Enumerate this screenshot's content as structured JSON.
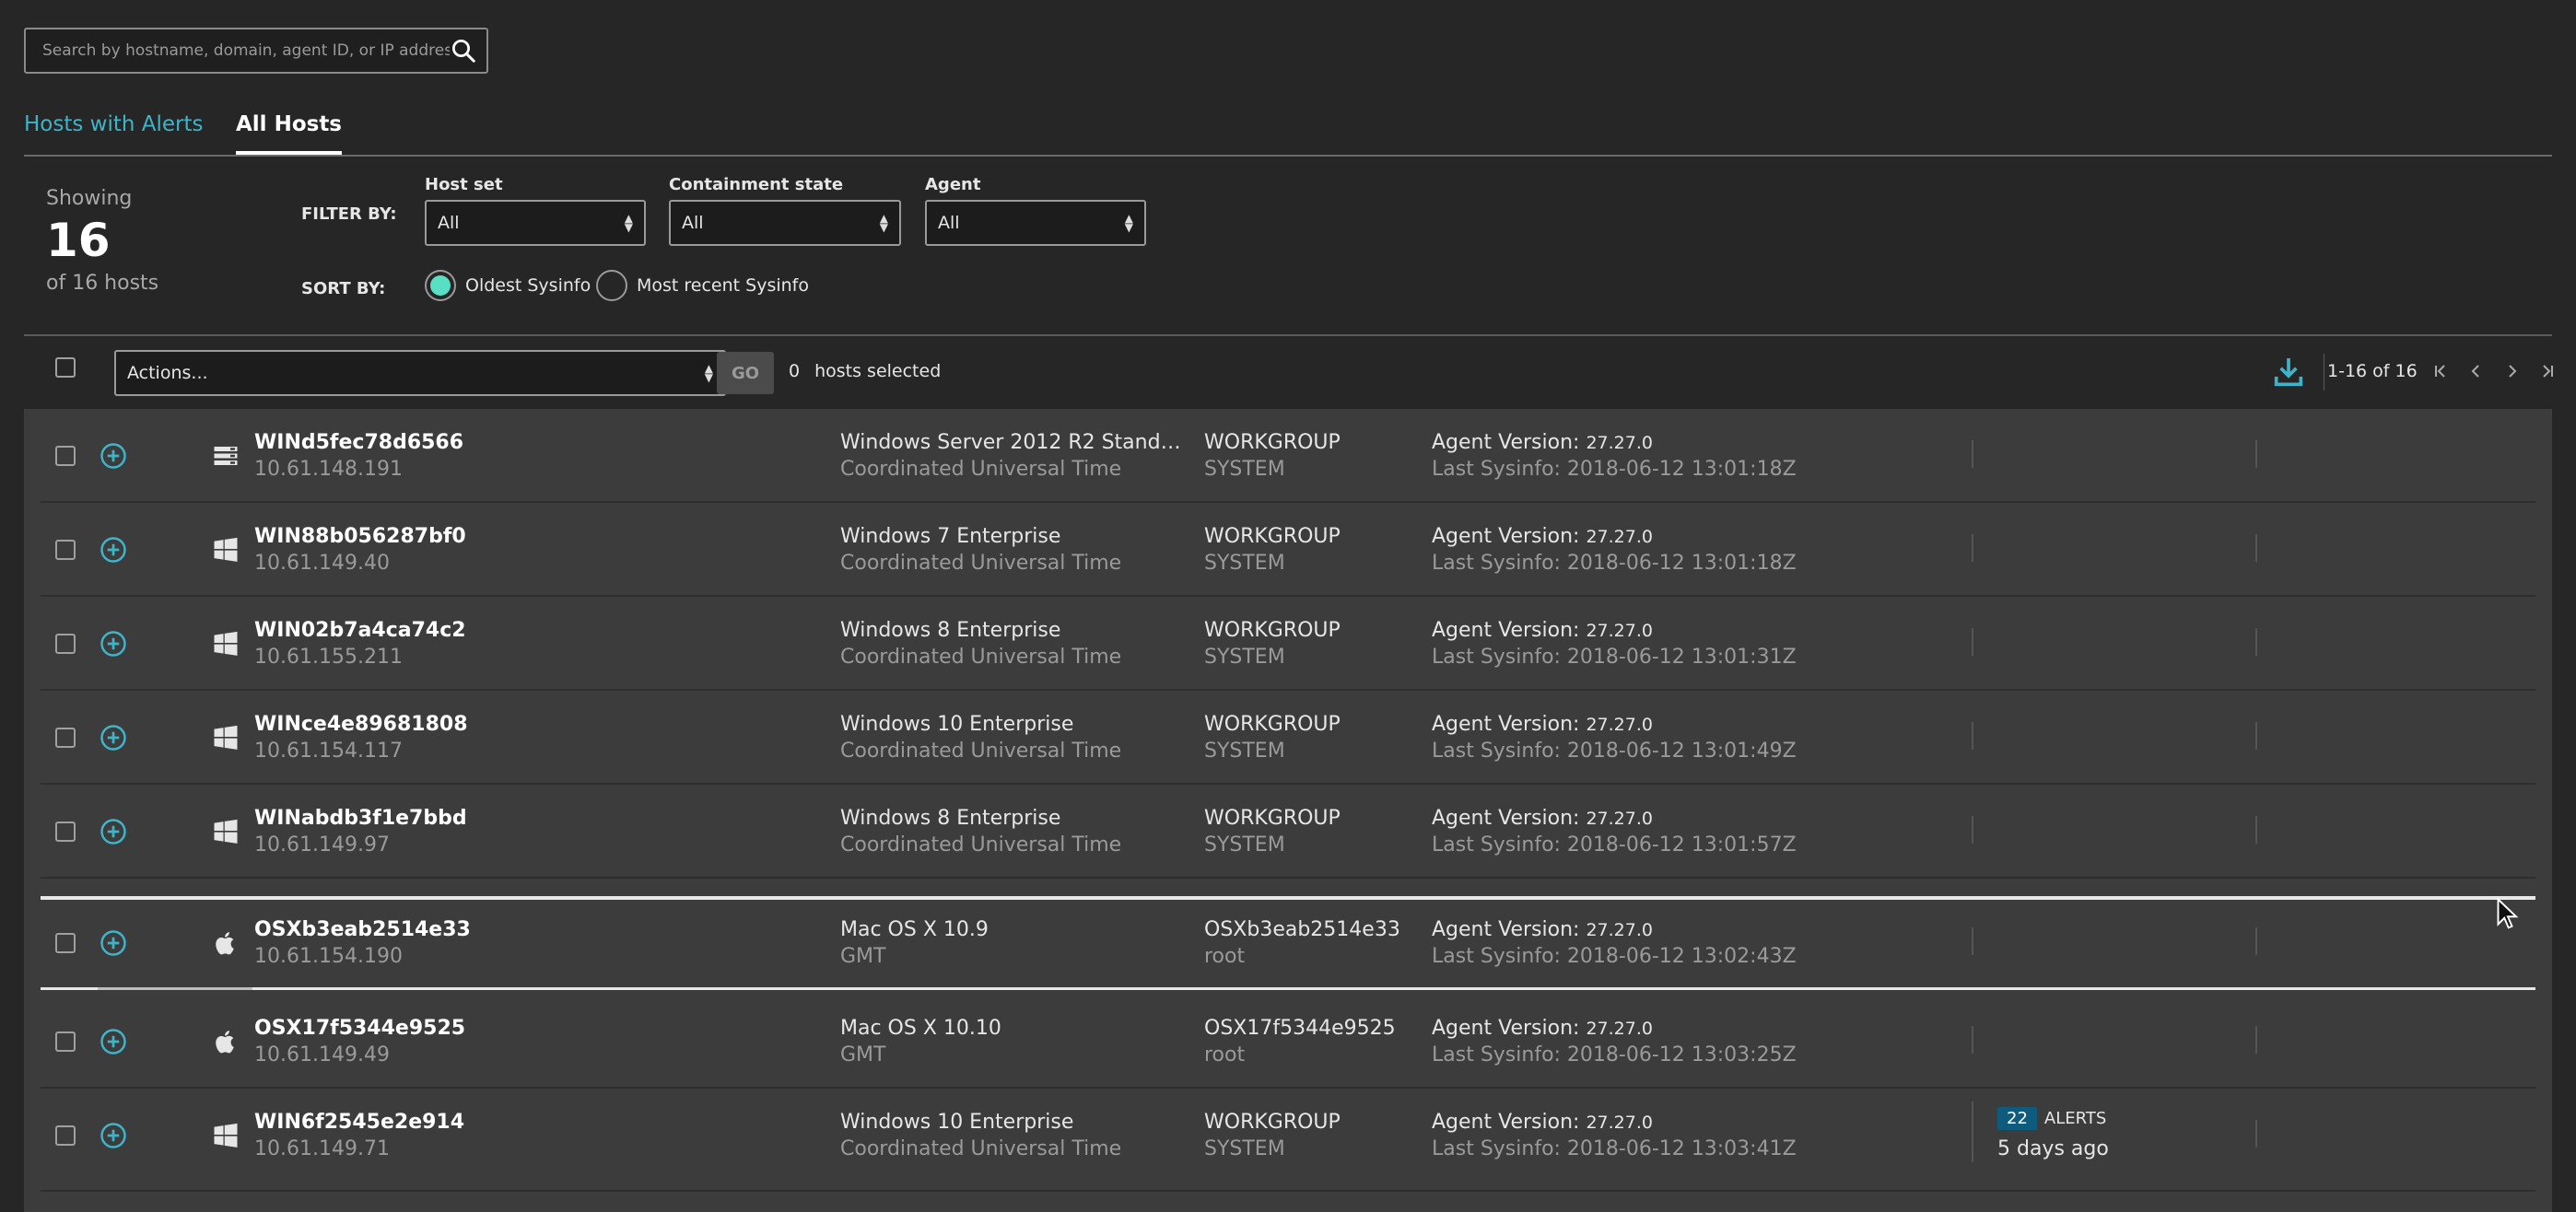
{
  "search": {
    "placeholder": "Search by hostname, domain, agent ID, or IP address"
  },
  "tabs": [
    {
      "label": "Hosts with Alerts"
    },
    {
      "label": "All Hosts"
    }
  ],
  "summary": {
    "showing_label": "Showing",
    "count": "16",
    "of_label": "of 16 hosts"
  },
  "filter": {
    "label": "FILTER BY:",
    "host_set": {
      "label": "Host set",
      "value": "All"
    },
    "containment": {
      "label": "Containment state",
      "value": "All"
    },
    "agent": {
      "label": "Agent",
      "value": "All"
    }
  },
  "sort": {
    "label": "SORT BY:",
    "options": [
      {
        "label": "Oldest Sysinfo",
        "selected": true
      },
      {
        "label": "Most recent Sysinfo",
        "selected": false
      }
    ]
  },
  "actionbar": {
    "actions_placeholder": "Actions...",
    "go_label": "GO",
    "selected_count": "0",
    "selected_label": "hosts selected",
    "page_info": "1-16 of 16"
  },
  "colors": {
    "accent": "#3fb4c8",
    "radio_on": "#59e0c4",
    "badge": "#0f5b7d"
  },
  "rows": [
    {
      "icon": "server-icon",
      "name": "WINd5fec78d6566",
      "ip": "10.61.148.191",
      "os": "Windows Server 2012 R2 Standa...",
      "tz": "Coordinated Universal Time",
      "domain": "WORKGROUP",
      "user": "SYSTEM",
      "agent_label": "Agent Version:",
      "agent_version": "27.27.0",
      "sysinfo": "Last Sysinfo: 2018-06-12 13:01:18Z"
    },
    {
      "icon": "windows-icon",
      "name": "WIN88b056287bf0",
      "ip": "10.61.149.40",
      "os": "Windows 7 Enterprise",
      "tz": "Coordinated Universal Time",
      "domain": "WORKGROUP",
      "user": "SYSTEM",
      "agent_label": "Agent Version:",
      "agent_version": "27.27.0",
      "sysinfo": "Last Sysinfo: 2018-06-12 13:01:18Z"
    },
    {
      "icon": "windows-icon",
      "name": "WIN02b7a4ca74c2",
      "ip": "10.61.155.211",
      "os": "Windows 8 Enterprise",
      "tz": "Coordinated Universal Time",
      "domain": "WORKGROUP",
      "user": "SYSTEM",
      "agent_label": "Agent Version:",
      "agent_version": "27.27.0",
      "sysinfo": "Last Sysinfo: 2018-06-12 13:01:31Z"
    },
    {
      "icon": "windows-icon",
      "name": "WINce4e89681808",
      "ip": "10.61.154.117",
      "os": "Windows 10 Enterprise",
      "tz": "Coordinated Universal Time",
      "domain": "WORKGROUP",
      "user": "SYSTEM",
      "agent_label": "Agent Version:",
      "agent_version": "27.27.0",
      "sysinfo": "Last Sysinfo: 2018-06-12 13:01:49Z"
    },
    {
      "icon": "windows-icon",
      "name": "WINabdb3f1e7bbd",
      "ip": "10.61.149.97",
      "os": "Windows 8 Enterprise",
      "tz": "Coordinated Universal Time",
      "domain": "WORKGROUP",
      "user": "SYSTEM",
      "agent_label": "Agent Version:",
      "agent_version": "27.27.0",
      "sysinfo": "Last Sysinfo: 2018-06-12 13:01:57Z"
    },
    {
      "icon": "apple-icon",
      "name": "OSXb3eab2514e33",
      "ip": "10.61.154.190",
      "os": "Mac OS X 10.9",
      "tz": "GMT",
      "domain": "OSXb3eab2514e33",
      "user": "root",
      "agent_label": "Agent Version:",
      "agent_version": "27.27.0",
      "sysinfo": "Last Sysinfo: 2018-06-12 13:02:43Z"
    },
    {
      "icon": "apple-icon",
      "name": "OSX17f5344e9525",
      "ip": "10.61.149.49",
      "os": "Mac OS X 10.10",
      "tz": "GMT",
      "domain": "OSX17f5344e9525",
      "user": "root",
      "agent_label": "Agent Version:",
      "agent_version": "27.27.0",
      "sysinfo": "Last Sysinfo: 2018-06-12 13:03:25Z"
    },
    {
      "icon": "windows-icon",
      "name": "WIN6f2545e2e914",
      "ip": "10.61.149.71",
      "os": "Windows 10 Enterprise",
      "tz": "Coordinated Universal Time",
      "domain": "WORKGROUP",
      "user": "SYSTEM",
      "agent_label": "Agent Version:",
      "agent_version": "27.27.0",
      "sysinfo": "Last Sysinfo: 2018-06-12 13:03:41Z",
      "alert_count": "22",
      "alert_label": "ALERTS",
      "alert_age": "5 days ago"
    }
  ]
}
